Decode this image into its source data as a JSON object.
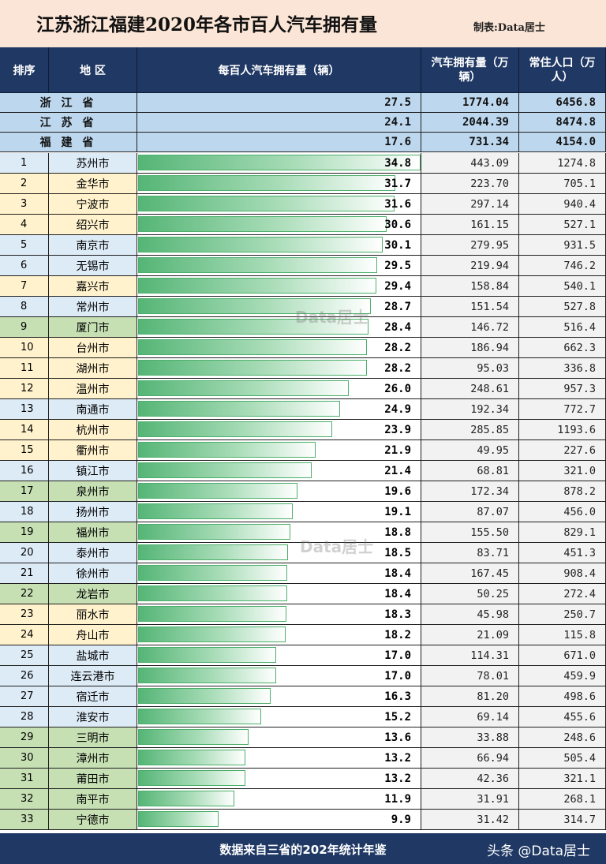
{
  "title": "江苏浙江福建2020年各市百人汽车拥有量",
  "credit": "制表:Data居士",
  "headers": {
    "rank": "排序",
    "region": "地 区",
    "per100": "每百人汽车拥有量（辆）",
    "cars": "汽车拥有量（万辆）",
    "pop": "常住人口（万人）"
  },
  "watermark": "Data居士",
  "footnote": "数据来自三省的202年统计年鉴",
  "brand": "头条 @Data居士",
  "colors": {
    "header": "#1f3864",
    "province": "#bdd7ee",
    "jiangsu": "#ddebf7",
    "zhejiang": "#fff2cc",
    "fujian": "#c6e0b4",
    "bar": "#55b576"
  },
  "chart_data": {
    "type": "bar",
    "title": "江苏浙江福建2020年各市百人汽车拥有量",
    "orientation": "horizontal",
    "value_label": "每百人汽车拥有量（辆）",
    "provinces": [
      {
        "name": "浙 江 省",
        "per100": "27.5",
        "cars": "1774.04",
        "pop": "6456.8"
      },
      {
        "name": "江 苏 省",
        "per100": "24.1",
        "cars": "2044.39",
        "pop": "8474.8"
      },
      {
        "name": "福 建 省",
        "per100": "17.6",
        "cars": "731.34",
        "pop": "4154.0"
      }
    ],
    "cities": [
      {
        "rank": "1",
        "name": "苏州市",
        "prov": "js",
        "per100": "34.8",
        "cars": "443.09",
        "pop": "1274.8"
      },
      {
        "rank": "2",
        "name": "金华市",
        "prov": "zj",
        "per100": "31.7",
        "cars": "223.70",
        "pop": "705.1"
      },
      {
        "rank": "3",
        "name": "宁波市",
        "prov": "zj",
        "per100": "31.6",
        "cars": "297.14",
        "pop": "940.4"
      },
      {
        "rank": "4",
        "name": "绍兴市",
        "prov": "zj",
        "per100": "30.6",
        "cars": "161.15",
        "pop": "527.1"
      },
      {
        "rank": "5",
        "name": "南京市",
        "prov": "js",
        "per100": "30.1",
        "cars": "279.95",
        "pop": "931.5"
      },
      {
        "rank": "6",
        "name": "无锡市",
        "prov": "js",
        "per100": "29.5",
        "cars": "219.94",
        "pop": "746.2"
      },
      {
        "rank": "7",
        "name": "嘉兴市",
        "prov": "zj",
        "per100": "29.4",
        "cars": "158.84",
        "pop": "540.1"
      },
      {
        "rank": "8",
        "name": "常州市",
        "prov": "js",
        "per100": "28.7",
        "cars": "151.54",
        "pop": "527.8"
      },
      {
        "rank": "9",
        "name": "厦门市",
        "prov": "fj",
        "per100": "28.4",
        "cars": "146.72",
        "pop": "516.4"
      },
      {
        "rank": "10",
        "name": "台州市",
        "prov": "zj",
        "per100": "28.2",
        "cars": "186.94",
        "pop": "662.3"
      },
      {
        "rank": "11",
        "name": "湖州市",
        "prov": "zj",
        "per100": "28.2",
        "cars": "95.03",
        "pop": "336.8"
      },
      {
        "rank": "12",
        "name": "温州市",
        "prov": "zj",
        "per100": "26.0",
        "cars": "248.61",
        "pop": "957.3"
      },
      {
        "rank": "13",
        "name": "南通市",
        "prov": "js",
        "per100": "24.9",
        "cars": "192.34",
        "pop": "772.7"
      },
      {
        "rank": "14",
        "name": "杭州市",
        "prov": "zj",
        "per100": "23.9",
        "cars": "285.85",
        "pop": "1193.6"
      },
      {
        "rank": "15",
        "name": "衢州市",
        "prov": "zj",
        "per100": "21.9",
        "cars": "49.95",
        "pop": "227.6"
      },
      {
        "rank": "16",
        "name": "镇江市",
        "prov": "js",
        "per100": "21.4",
        "cars": "68.81",
        "pop": "321.0"
      },
      {
        "rank": "17",
        "name": "泉州市",
        "prov": "fj",
        "per100": "19.6",
        "cars": "172.34",
        "pop": "878.2"
      },
      {
        "rank": "18",
        "name": "扬州市",
        "prov": "js",
        "per100": "19.1",
        "cars": "87.07",
        "pop": "456.0"
      },
      {
        "rank": "19",
        "name": "福州市",
        "prov": "fj",
        "per100": "18.8",
        "cars": "155.50",
        "pop": "829.1"
      },
      {
        "rank": "20",
        "name": "泰州市",
        "prov": "js",
        "per100": "18.5",
        "cars": "83.71",
        "pop": "451.3"
      },
      {
        "rank": "21",
        "name": "徐州市",
        "prov": "js",
        "per100": "18.4",
        "cars": "167.45",
        "pop": "908.4"
      },
      {
        "rank": "22",
        "name": "龙岩市",
        "prov": "fj",
        "per100": "18.4",
        "cars": "50.25",
        "pop": "272.4"
      },
      {
        "rank": "23",
        "name": "丽水市",
        "prov": "zj",
        "per100": "18.3",
        "cars": "45.98",
        "pop": "250.7"
      },
      {
        "rank": "24",
        "name": "舟山市",
        "prov": "zj",
        "per100": "18.2",
        "cars": "21.09",
        "pop": "115.8"
      },
      {
        "rank": "25",
        "name": "盐城市",
        "prov": "js",
        "per100": "17.0",
        "cars": "114.31",
        "pop": "671.0"
      },
      {
        "rank": "26",
        "name": "连云港市",
        "prov": "js",
        "per100": "17.0",
        "cars": "78.01",
        "pop": "459.9"
      },
      {
        "rank": "27",
        "name": "宿迁市",
        "prov": "js",
        "per100": "16.3",
        "cars": "81.20",
        "pop": "498.6"
      },
      {
        "rank": "28",
        "name": "淮安市",
        "prov": "js",
        "per100": "15.2",
        "cars": "69.14",
        "pop": "455.6"
      },
      {
        "rank": "29",
        "name": "三明市",
        "prov": "fj",
        "per100": "13.6",
        "cars": "33.88",
        "pop": "248.6"
      },
      {
        "rank": "30",
        "name": "漳州市",
        "prov": "fj",
        "per100": "13.2",
        "cars": "66.94",
        "pop": "505.4"
      },
      {
        "rank": "31",
        "name": "莆田市",
        "prov": "fj",
        "per100": "13.2",
        "cars": "42.36",
        "pop": "321.1"
      },
      {
        "rank": "32",
        "name": "南平市",
        "prov": "fj",
        "per100": "11.9",
        "cars": "31.91",
        "pop": "268.1"
      },
      {
        "rank": "33",
        "name": "宁德市",
        "prov": "fj",
        "per100": "9.9",
        "cars": "31.42",
        "pop": "314.7"
      }
    ],
    "xlim": [
      0,
      34.8
    ]
  }
}
